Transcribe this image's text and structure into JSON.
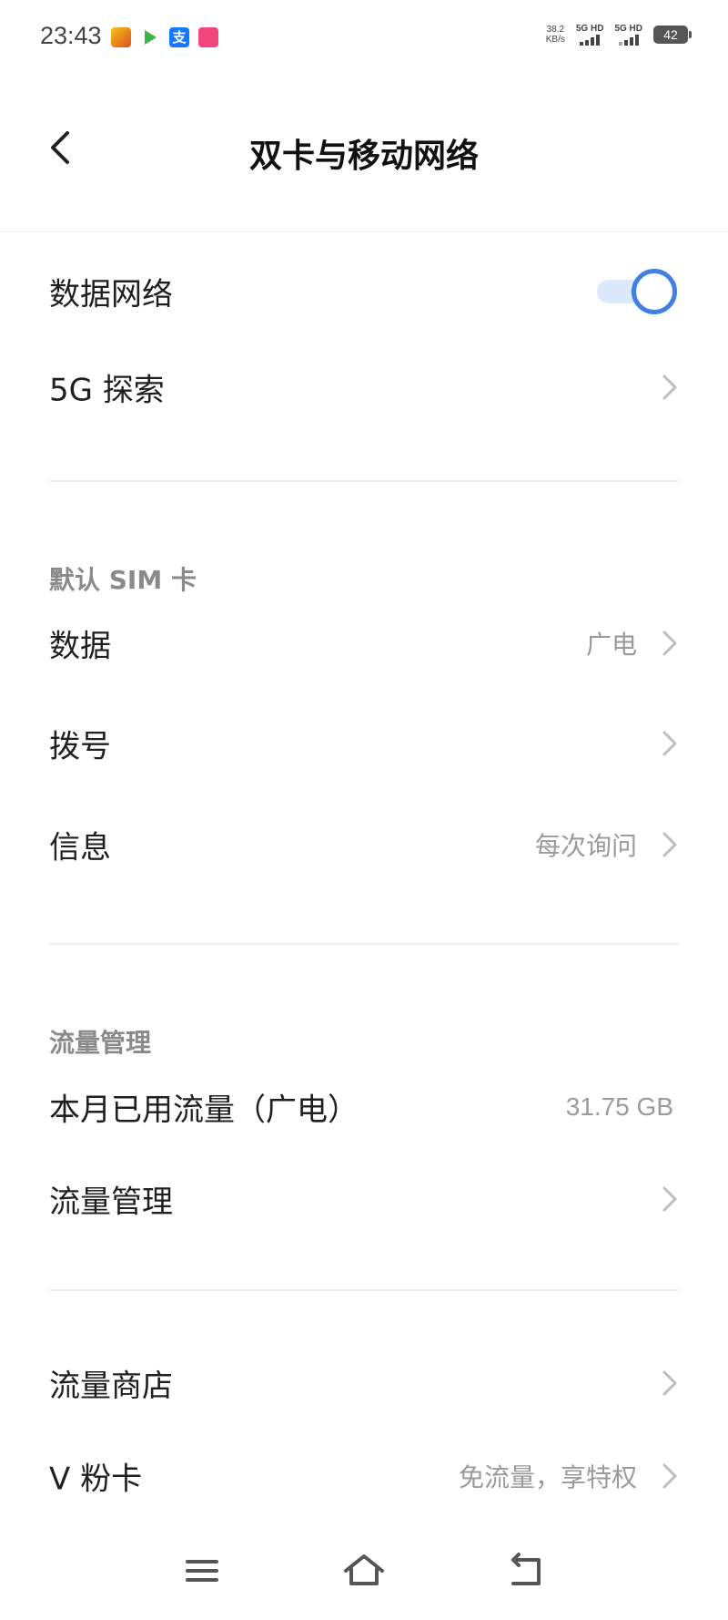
{
  "status_bar": {
    "time": "23:43",
    "app_icons": [
      "app-icon-1",
      "app-icon-2",
      "alipay-icon",
      "app-icon-4"
    ],
    "alipay_glyph": "支",
    "speed_value": "38.2",
    "speed_unit": "KB/s",
    "sim1_label": "5G HD",
    "sim2_label": "5G HD",
    "battery": "42"
  },
  "header": {
    "title": "双卡与移动网络",
    "back_icon": "chevron-left-icon"
  },
  "sections": {
    "network": {
      "items": [
        {
          "label": "数据网络",
          "toggle_on": true
        },
        {
          "label": "5G 探索"
        }
      ]
    },
    "default_sim": {
      "title": "默认 SIM 卡",
      "items": [
        {
          "label": "数据",
          "value": "广电"
        },
        {
          "label": "拨号",
          "value": ""
        },
        {
          "label": "信息",
          "value": "每次询问"
        }
      ]
    },
    "traffic": {
      "title": "流量管理",
      "items": [
        {
          "label": "本月已用流量（广电）",
          "value": "31.75 GB"
        },
        {
          "label": "流量管理"
        }
      ]
    },
    "store": {
      "items": [
        {
          "label": "流量商店"
        },
        {
          "label": "V 粉卡",
          "value": "免流量，享特权"
        }
      ]
    }
  },
  "colors": {
    "accent": "#3f7fe6",
    "toggle_track": "#dce8fb",
    "secondary_text": "#9a9a9a",
    "section_header": "#8a8a8a"
  },
  "nav_bar": {
    "icons": [
      "menu-icon",
      "home-icon",
      "back-icon"
    ]
  }
}
